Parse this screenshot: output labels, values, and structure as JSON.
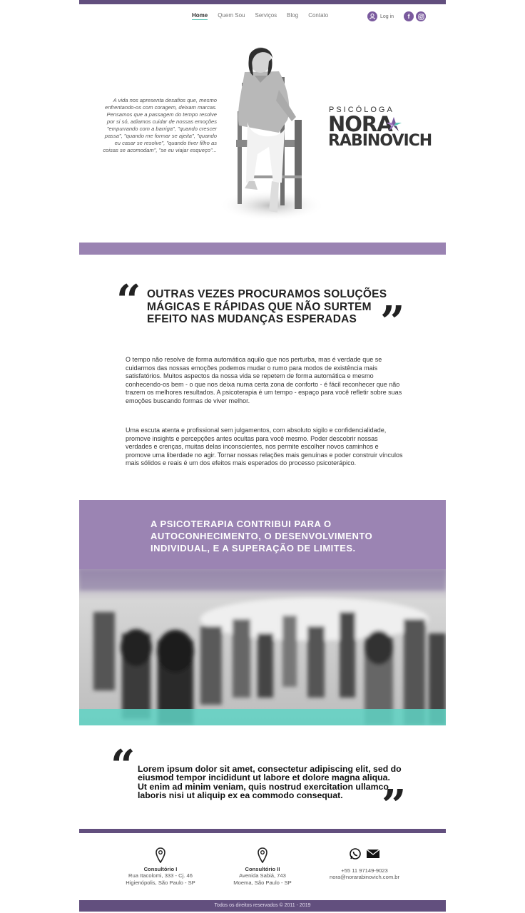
{
  "nav": {
    "items": [
      "Home",
      "Quem Sou",
      "Serviços",
      "Blog",
      "Contato"
    ],
    "login": "Log in",
    "social": [
      "facebook-icon",
      "instagram-icon"
    ]
  },
  "hero": {
    "intro": "A vida nos apresenta desafios que, mesmo enfrentando-os com coragem, deixam marcas.  Pensamos que a passagem do tempo resolve por si só, adiamos cuidar de nossas emoções \"empurrando com a barriga\", \"quando crescer passa\", \"quando me formar se ajeita\", \"quando eu casar se resolve\", \"quando tiver filho as coisas se acomodam\", \"se eu viajar esqueço\"...",
    "brand_title": "PSICÓLOGA",
    "brand_name_1": "NORA",
    "brand_name_2": "RABINOVICH"
  },
  "quote1": {
    "text": "OUTRAS VEZES PROCURAMOS SOLUÇÕES MÁGICAS E RÁPIDAS QUE NÃO SURTEM EFEITO NAS MUDANÇAS ESPERADAS",
    "para1": "O tempo não resolve de forma automática aquilo que nos perturba, mas é verdade que se cuidarmos das nossas emoções podemos mudar o rumo para modos de existência mais satisfatórios. Muitos aspectos da nossa vida se repetem de forma automática e mesmo conhecendo-os bem - o que nos deixa numa certa zona de conforto - é fácil reconhecer que não trazem os melhores resultados. A psicoterapia é um tempo - espaço para você refletir sobre suas emoções buscando formas de viver melhor.",
    "para2": "Uma escuta atenta e profissional sem julgamentos, com absoluto sigilo e confidencialidade, promove insights e percepções antes ocultas para você mesmo. Poder descobrir nossas verdades e crenças, muitas delas inconscientes, nos permite escolher novos caminhos e promove uma liberdade no agir. Tornar nossas relações mais genuínas e poder construir vínculos mais sólidos e reais é um dos efeitos mais esperados do processo psicoterápico."
  },
  "banner": {
    "text": "A PSICOTERAPIA CONTRIBUI PARA O AUTOCONHECIMENTO, O DESENVOLVIMENTO INDIVIDUAL, E A SUPERAÇÃO DE LIMITES."
  },
  "quote2": {
    "text": "Lorem ipsum dolor sit amet, consectetur adipiscing elit, sed do eiusmod tempor incididunt ut labore et dolore magna aliqua. Ut enim ad minim veniam, quis nostrud exercitation ullamco laboris nisi ut aliquip ex ea commodo consequat."
  },
  "footer": {
    "office1": {
      "title": "Consultório I",
      "line1": "Rua Itacolomi, 333 - Cj. 46",
      "line2": "Higienópolis, São Paulo - SP"
    },
    "office2": {
      "title": "Consultório II",
      "line1": "Avenida Sabiá, 743",
      "line2": "Moema, São Paulo - SP"
    },
    "contact": {
      "phone": "+55  11  97149-9023",
      "email": "nora@norarabinovich.com.br"
    },
    "copyright": "Todos os direitos reservados © 2011 - 2019"
  },
  "colors": {
    "purple_dark": "#624f7e",
    "purple_light": "#9a83b2",
    "teal": "#5fc6b8"
  }
}
